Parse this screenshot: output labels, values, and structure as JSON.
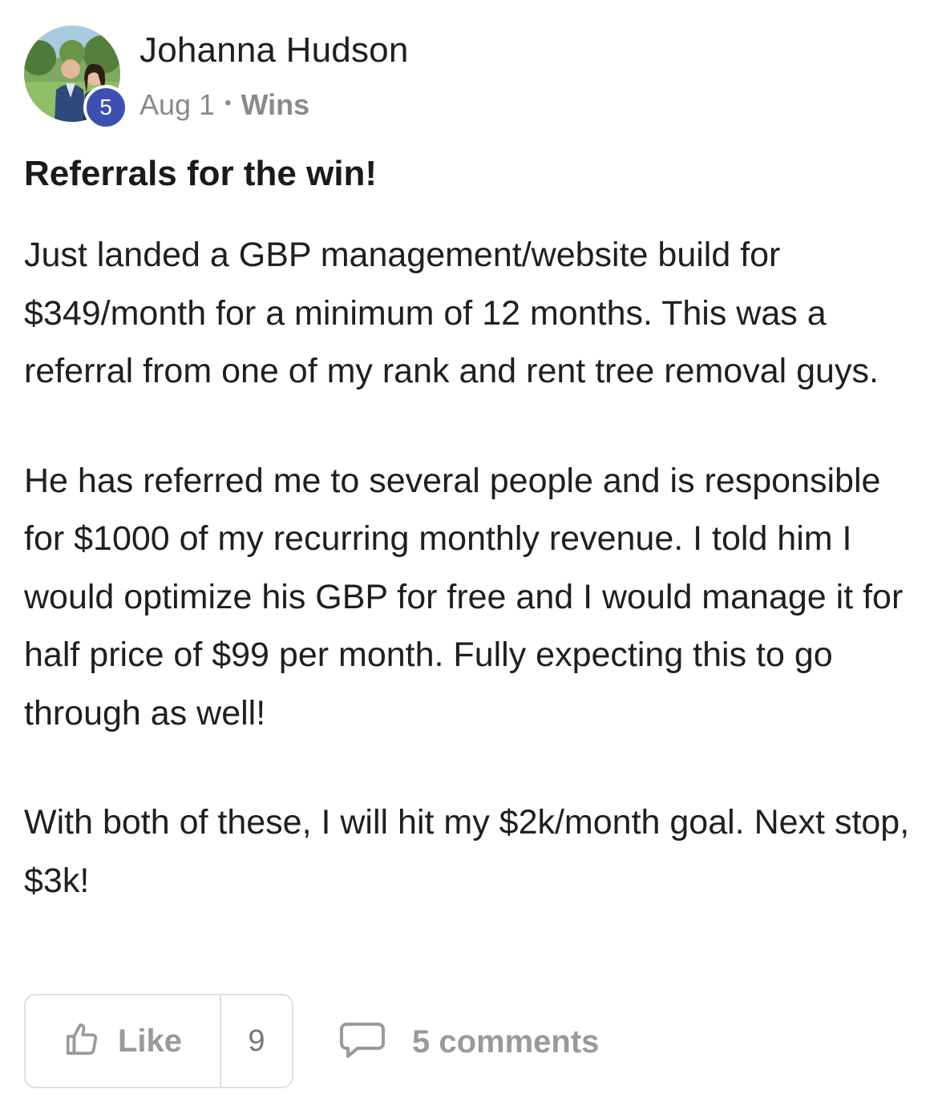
{
  "post": {
    "author": {
      "name": "Johanna Hudson",
      "level": "5",
      "avatar_icon": "profile-photo"
    },
    "meta": {
      "date": "Aug 1",
      "separator": "•",
      "category": "Wins"
    },
    "title": "Referrals for the win!",
    "paragraphs": [
      "Just landed a GBP management/website build for $349/month for a minimum of 12 months. This was a referral from one of my rank and rent tree removal guys.",
      "He has referred me to several people and is responsible for $1000 of my recurring monthly revenue. I told him I would optimize his GBP for free and I would manage it for half price of $99 per month. Fully expecting this to go through as well!",
      "With both of these, I will hit my $2k/month goal. Next stop, $3k!"
    ],
    "actions": {
      "like_label": "Like",
      "like_count": "9",
      "comments_label": "5 comments",
      "like_icon": "thumbs-up-icon",
      "comment_icon": "comment-bubble-icon"
    }
  },
  "colors": {
    "level_badge": "#3d4fb0",
    "muted_text": "#8a8a8a",
    "border": "#e0e0e0"
  }
}
